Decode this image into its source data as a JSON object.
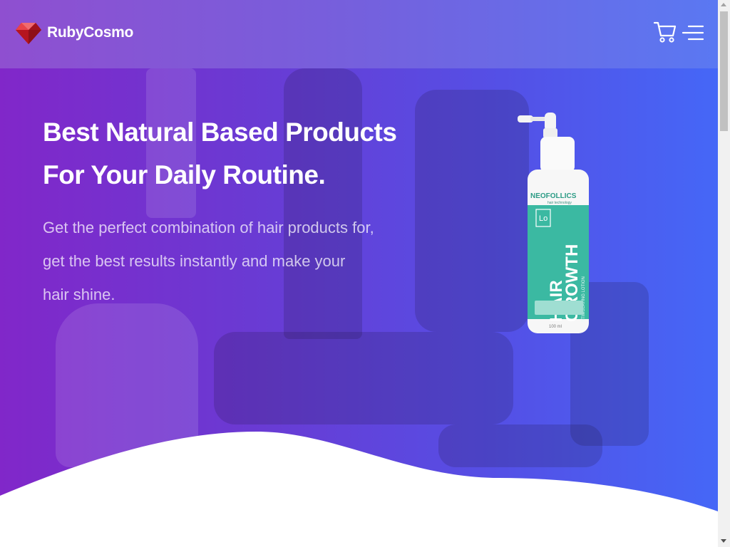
{
  "brand": {
    "name": "RubyCosmo",
    "logo_icon": "ruby-gem-icon",
    "logo_color": "#d8202a"
  },
  "header": {
    "cart_icon": "shopping-cart-icon",
    "menu_icon": "hamburger-menu-icon",
    "gradient": [
      "#8f4fd0",
      "#5a78f2"
    ]
  },
  "hero": {
    "title_line1": "Best Natural Based Products",
    "title_line2": "For Your Daily Routine.",
    "desc_line1": "Get the perfect combination of hair products for,",
    "desc_line2": "get the best results instantly and make your",
    "desc_line3": "hair shine.",
    "gradient": [
      "#8127c9",
      "#4567f7"
    ]
  },
  "product": {
    "brand": "NEOFOLLICS",
    "brand_sub": "hair technology",
    "badge": "Lo",
    "name_line1": "HAIR",
    "name_line2": "GROWTH",
    "subtitle": "STIMULATING LOTION",
    "volume": "100 ml",
    "color": "#3bb9a2"
  }
}
